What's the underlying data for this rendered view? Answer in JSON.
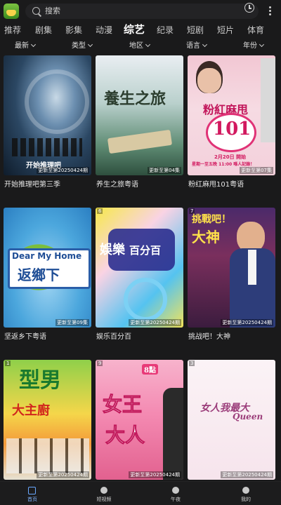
{
  "search": {
    "placeholder": "搜索"
  },
  "tabs": [
    "推荐",
    "剧集",
    "影集",
    "动漫",
    "综艺",
    "纪录",
    "短剧",
    "短片",
    "体育"
  ],
  "active_tab": "综艺",
  "filters": [
    "最新",
    "类型",
    "地区",
    "语言",
    "年份"
  ],
  "cards": [
    {
      "title": "开始推理吧第三季",
      "episode": "更新至第20250424期",
      "rank": "",
      "poster_text": "开始推理吧"
    },
    {
      "title": "养生之旅粤语",
      "episode": "更新至第04集",
      "rank": "",
      "poster_text": "養生之旅"
    },
    {
      "title": "粉红麻甩101粤语",
      "episode": "更新至第07集",
      "rank": "",
      "poster_text": "粉紅麻甩",
      "poster_text2": "101",
      "poster_text3": "2月20日 開始",
      "poster_text4": "星期一至五晚 11:00 喺人記錄！"
    },
    {
      "title": "坚返乡下粤语",
      "episode": "更新至第09集",
      "rank": "",
      "poster_text": "Dear My Home",
      "poster_text2": "返鄉下"
    },
    {
      "title": "娱乐百分百",
      "episode": "更新至第20250424期",
      "rank": "6",
      "poster_text": "娛樂",
      "poster_text2": "百分百"
    },
    {
      "title": "挑战吧！大神",
      "episode": "更新至第20250424期",
      "rank": "7",
      "poster_text": "挑戰吧！",
      "poster_text2": "大神"
    },
    {
      "title": "",
      "episode": "更新至第20250424期",
      "rank": "1",
      "poster_text": "型男",
      "poster_text2": "大主廚"
    },
    {
      "title": "",
      "episode": "更新至第20250424期",
      "rank": "9",
      "poster_text": "女王",
      "poster_text2": "大人",
      "poster_text3": "8點"
    },
    {
      "title": "",
      "episode": "更新至第20250424期",
      "rank": "3",
      "poster_text": "女人我最大",
      "poster_text2": "Queen"
    }
  ],
  "bottom_nav": [
    "首页",
    "短视频",
    "午夜",
    "我的"
  ],
  "colors": {
    "background": "#1a1a1b",
    "accent": "#7fb3ff"
  }
}
